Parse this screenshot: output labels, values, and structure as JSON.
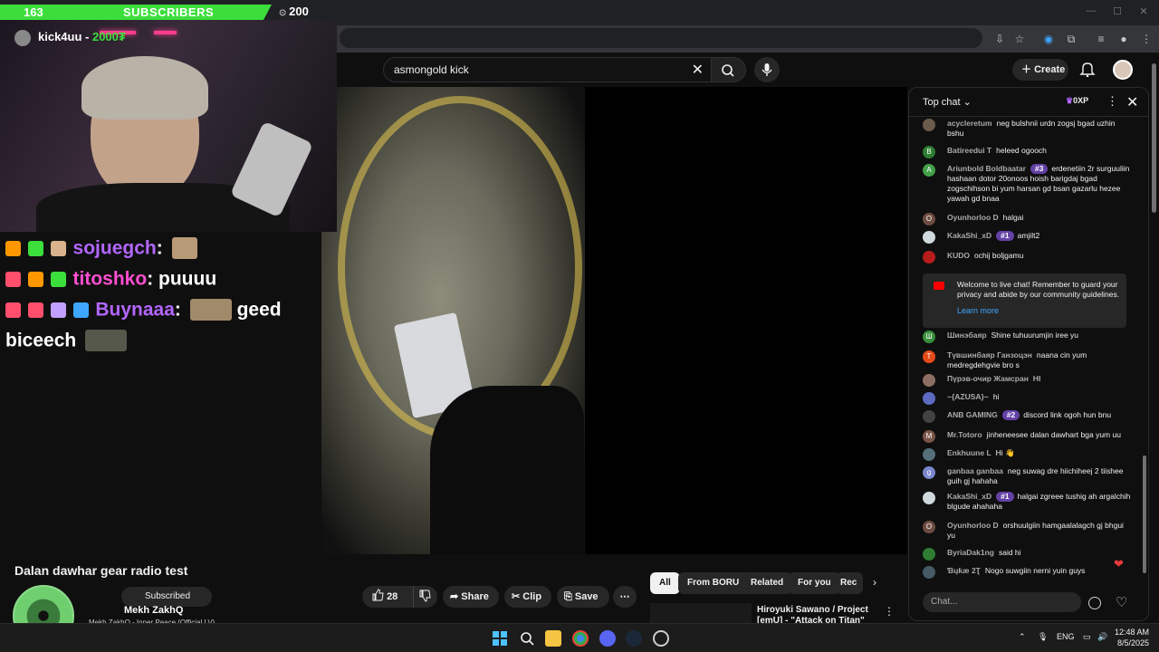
{
  "overlay": {
    "sub_count": "163",
    "sub_label": "SUBSCRIBERS",
    "sub_goal": "200",
    "kick_user": "kick4uu - ",
    "kick_amount": "2000₮",
    "chat": [
      {
        "name": "sojuegch",
        "msg": "",
        "color": "#b266ff"
      },
      {
        "name": "titoshko",
        "msg": "puuuu",
        "color": "#ff4fd1"
      },
      {
        "name": "Buynaaa",
        "msg": "geed",
        "color": "#b266ff"
      },
      {
        "name": "",
        "msg": "biceech",
        "color": "#ffffff"
      }
    ]
  },
  "youtube": {
    "search_value": "asmongold kick",
    "create_label": "Create",
    "video_title": "Dalan dawhar gear radio test",
    "subscribed_label": "Subscribed",
    "like_count": "28",
    "share_label": "Share",
    "clip_label": "Clip",
    "save_label": "Save",
    "chips": [
      "All",
      "From BORU",
      "Related",
      "For you",
      "Rec"
    ],
    "related_title": "Hiroyuki Sawano / Project [emU] - \"Attack on Titan\" suite"
  },
  "now_playing": {
    "artist": "Mekh ZakhQ",
    "track": "Mekh ZakhQ - Inner Peace (Official LV)"
  },
  "chat": {
    "title": "Top chat",
    "xp": "0XP",
    "welcome_text": "Welcome to live chat! Remember to guard your privacy and abide by our community guidelines.",
    "learn_more": "Learn more",
    "input_placeholder": "Chat...",
    "messages": [
      {
        "author": "acycleretum",
        "rank": "",
        "text": "neg bulshnii urdn zogsj bgad uzhin bshu",
        "av": "",
        "color": "#6b5b4b"
      },
      {
        "author": "Batireedui T",
        "rank": "",
        "text": "heleed ogooch",
        "av": "B",
        "color": "#2e7d32"
      },
      {
        "author": "Ariunbold Boldbaatar",
        "rank": "#3",
        "text": "erdenetiin 2r surguuliin hashaan dotor 20onoos hoish barigdaj bgad zogschihson bi yum harsan gd bsan gazarlu hezee yawah gd bnaa",
        "av": "A",
        "color": "#43a047"
      },
      {
        "author": "Oyunhorloo D",
        "rank": "",
        "text": "halgai",
        "av": "O",
        "color": "#6d4c41"
      },
      {
        "author": "KakaShi_xD",
        "rank": "#1",
        "text": "amjilt2",
        "av": "",
        "color": "#cfd8dc"
      },
      {
        "author": "KUDO",
        "rank": "",
        "text": "ochij boljgamu",
        "av": "",
        "color": "#b71c1c"
      },
      {
        "author": "Шинэбаяр",
        "rank": "",
        "text": "Shine tuhuurumjin iree yu",
        "av": "Ш",
        "color": "#388e3c"
      },
      {
        "author": "Түвшинбаяр Ганзоцэн",
        "rank": "",
        "text": "naana cin yum medregdehgvie bro s",
        "av": "T",
        "color": "#e64a19"
      },
      {
        "author": "Пүрэв-очир Жамсран",
        "rank": "",
        "text": "HI",
        "av": "",
        "color": "#8d6e63"
      },
      {
        "author": "~{AZUSA}~",
        "rank": "",
        "text": "hi",
        "av": "",
        "color": "#5c6bc0"
      },
      {
        "author": "ANB GAMING",
        "rank": "#2",
        "text": "discord link ogoh hun bnu",
        "av": "",
        "color": "#424242"
      },
      {
        "author": "Mr.Totoro",
        "rank": "",
        "text": "jinheneesee dalan dawhart bga yum uu",
        "av": "M",
        "color": "#795548"
      },
      {
        "author": "Enkhuune L",
        "rank": "",
        "text": "Hi 👋",
        "av": "",
        "color": "#546e7a"
      },
      {
        "author": "ganbaa ganbaa",
        "rank": "",
        "text": "neg suwag dre hiichiheej 2 tiishee guih gj hahaha",
        "av": "g",
        "color": "#7986cb"
      },
      {
        "author": "KakaShi_xD",
        "rank": "#1",
        "text": "halgai zgreee tushig ah argalchih blgude ahahaha",
        "av": "",
        "color": "#cfd8dc"
      },
      {
        "author": "Oyunhorloo D",
        "rank": "",
        "text": "orshuulgiin hamgaalalagch gj bhgui yu",
        "av": "O",
        "color": "#6d4c41"
      },
      {
        "author": "ByriaDak1ng",
        "rank": "",
        "text": "said hi",
        "av": "",
        "color": "#2e7d32"
      },
      {
        "author": "Ɓųƙæ 2Ʈ",
        "rank": "",
        "text": "Nogo suwgiin nerni yuin guys",
        "av": "",
        "color": "#455a64"
      }
    ]
  },
  "taskbar": {
    "lang": "ENG",
    "time": "12:48 AM",
    "date": "8/5/2025"
  },
  "colors": {
    "accent_green": "#3cde3c",
    "rank_purple": "#6441a5",
    "link_blue": "#3ea6ff"
  }
}
